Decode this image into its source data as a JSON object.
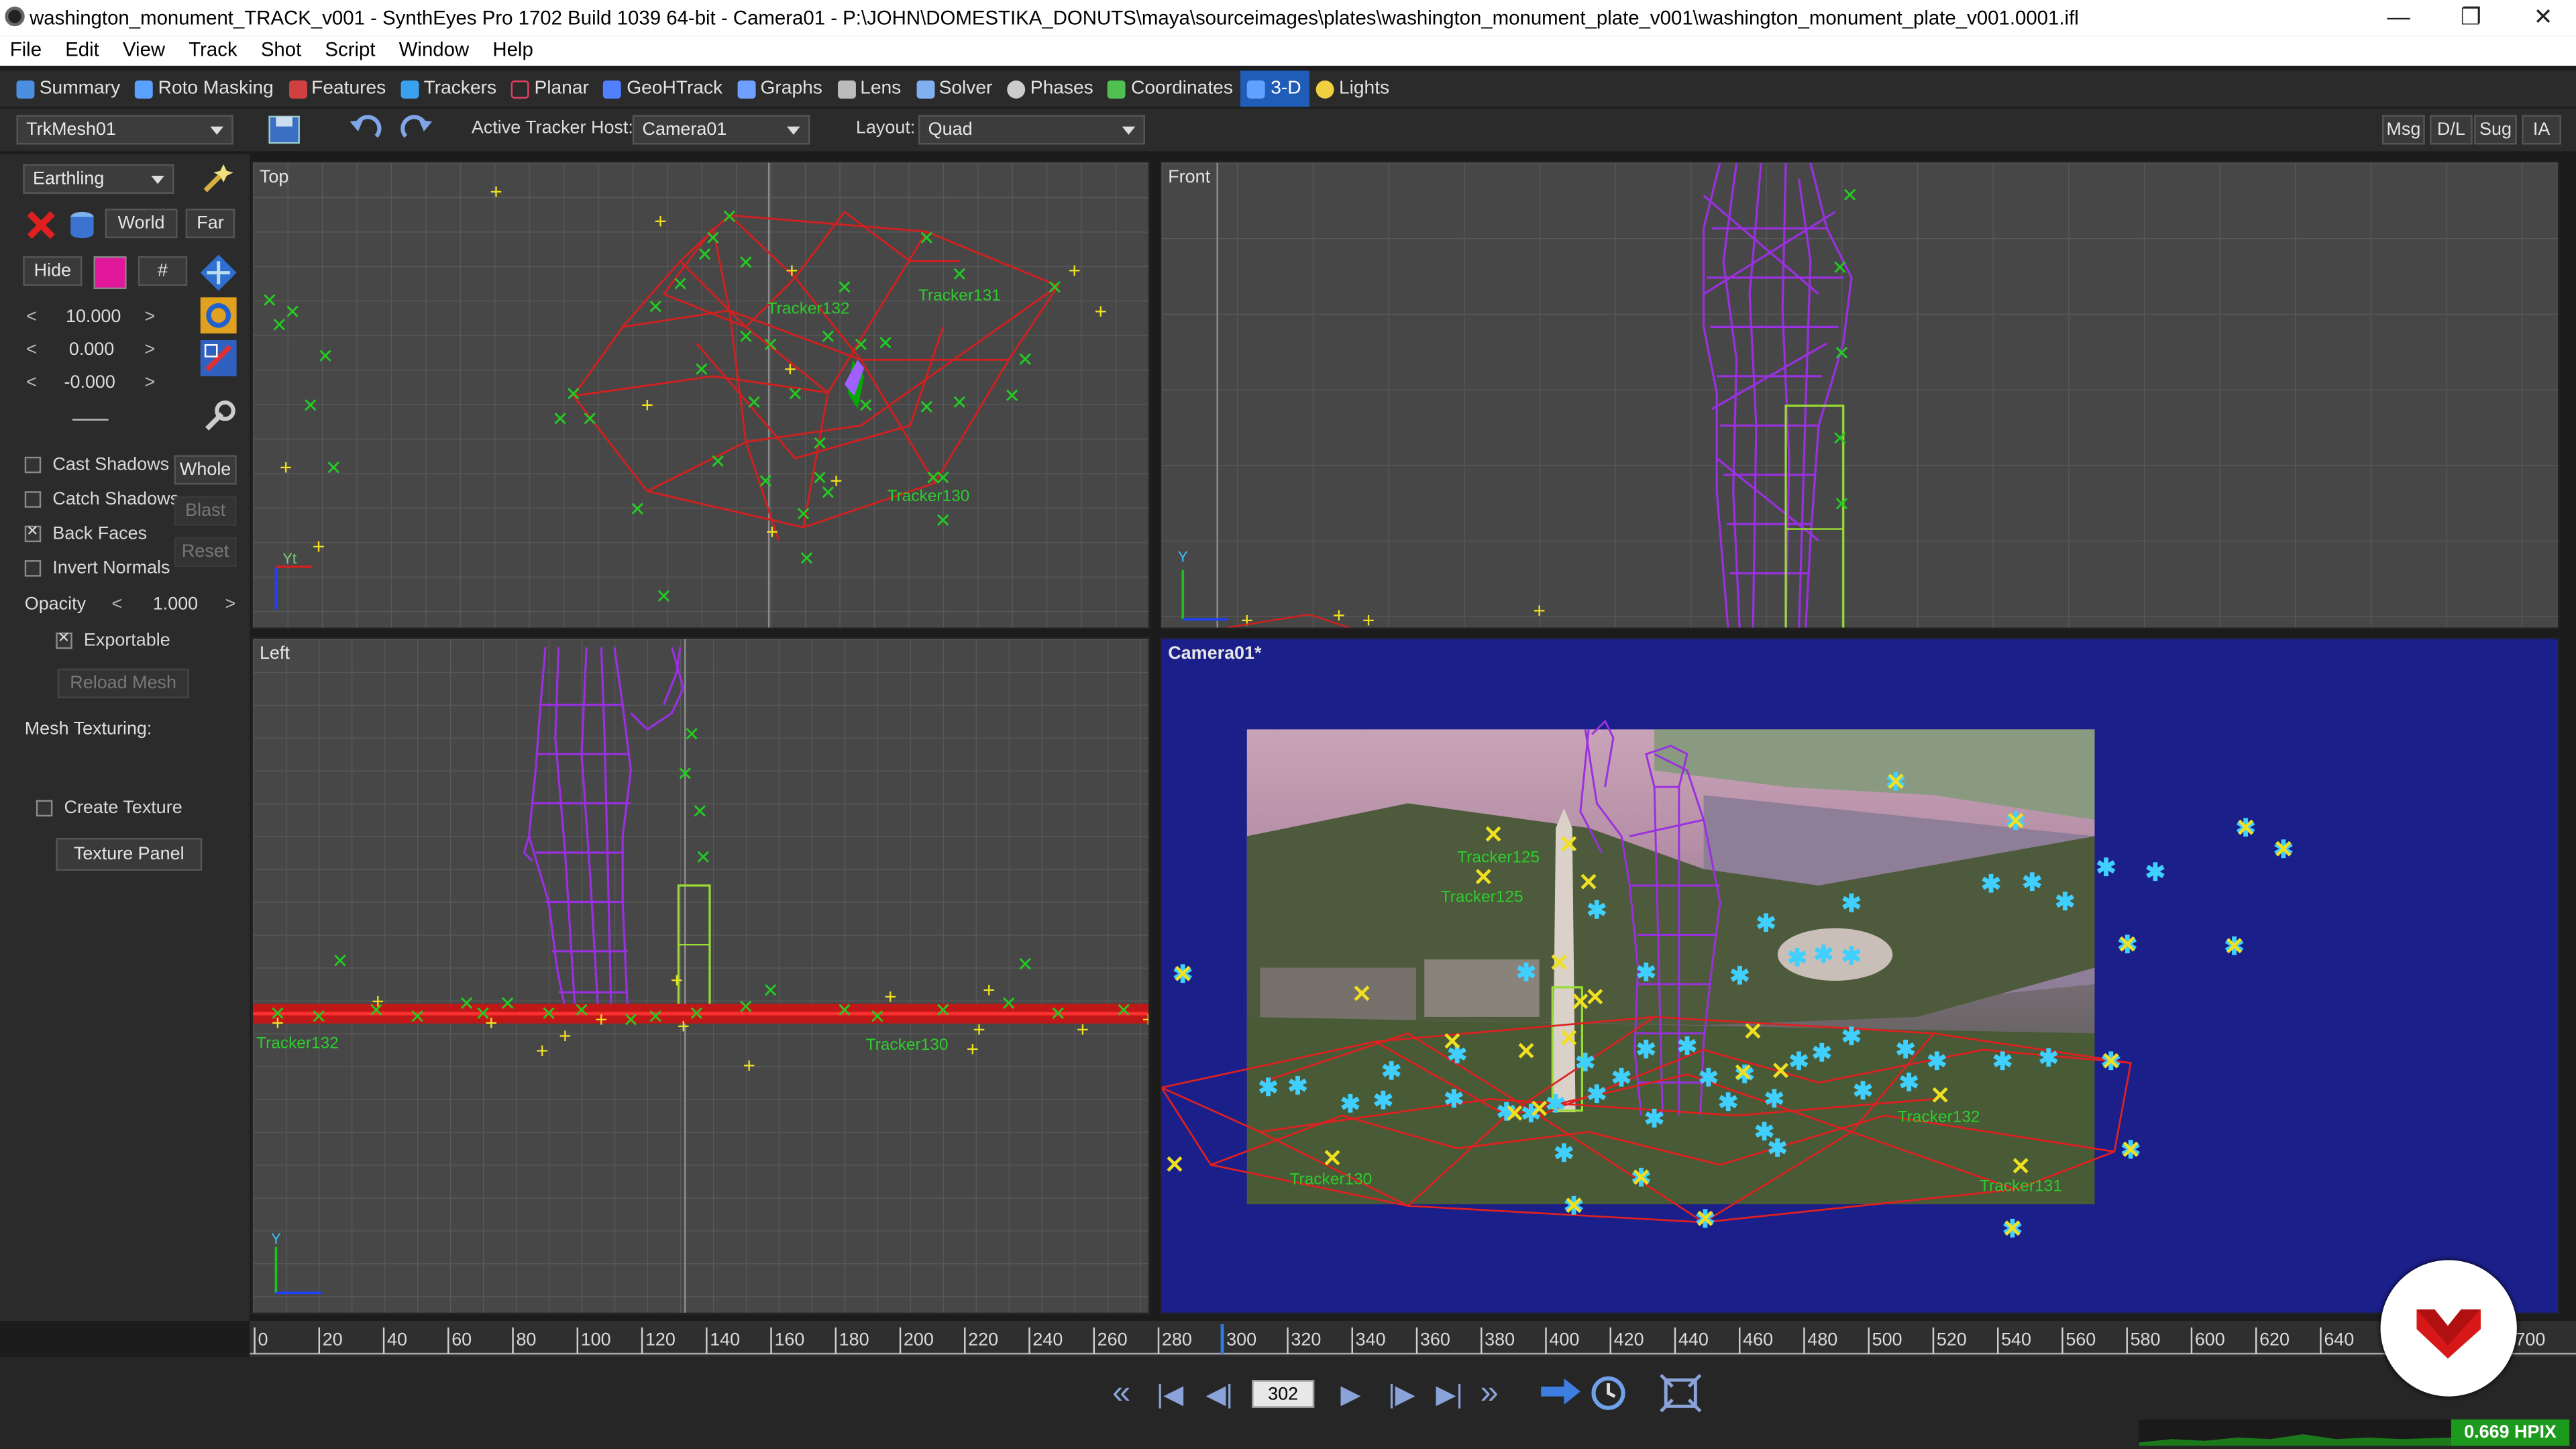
{
  "titlebar": {
    "title": "washington_monument_TRACK_v001 - SynthEyes Pro 1702 Build 1039 64-bit - Camera01 - P:\\JOHN\\DOMESTIKA_DONUTS\\maya\\sourceimages\\plates\\washington_monument_plate_v001\\washington_monument_plate_v001.0001.ifl",
    "minimize": "—",
    "restore": "❐",
    "close": "✕"
  },
  "menu": [
    "File",
    "Edit",
    "View",
    "Track",
    "Shot",
    "Script",
    "Window",
    "Help"
  ],
  "rooms": [
    {
      "label": "Summary",
      "color": "#4a8fe0"
    },
    {
      "label": "Roto Masking",
      "color": "#5aa0ff"
    },
    {
      "label": "Features",
      "color": "#d04040"
    },
    {
      "label": "Trackers",
      "color": "#3aa0f0"
    },
    {
      "label": "Planar",
      "color": "#e04060"
    },
    {
      "label": "GeoHTrack",
      "color": "#5080ff"
    },
    {
      "label": "Graphs",
      "color": "#70a0ff"
    },
    {
      "label": "Lens",
      "color": "#bbbbbb"
    },
    {
      "label": "Solver",
      "color": "#80b0f0"
    },
    {
      "label": "Phases",
      "color": "#cccccc"
    },
    {
      "label": "Coordinates",
      "color": "#50c050"
    },
    {
      "label": "3-D",
      "color": "#60a0ff",
      "active": true
    },
    {
      "label": "Lights",
      "color": "#f0d040"
    }
  ],
  "toolbar": {
    "mesh_select": "TrkMesh01",
    "active_tracker_host_label": "Active Tracker Host:",
    "active_tracker_host": "Camera01",
    "layout_label": "Layout:",
    "layout": "Quad",
    "right_buttons": [
      "Msg",
      "D/L",
      "Sug",
      "IA"
    ]
  },
  "left_panel": {
    "mode_select": "Earthling",
    "world_btn": "World",
    "far_btn": "Far",
    "hide_btn": "Hide",
    "hash_btn": "#",
    "color_swatch": "#e0169b",
    "values": [
      "10.000",
      "0.000",
      "-0.000"
    ],
    "cast_shadows": {
      "label": "Cast Shadows",
      "checked": false
    },
    "catch_shadows": {
      "label": "Catch Shadows",
      "checked": false
    },
    "back_faces": {
      "label": "Back Faces",
      "checked": true
    },
    "invert_normals": {
      "label": "Invert Normals",
      "checked": false
    },
    "whole_btn": "Whole",
    "blast_btn": "Blast",
    "reset_btn": "Reset",
    "opacity_label": "Opacity",
    "opacity_value": "1.000",
    "exportable": {
      "label": "Exportable",
      "checked": true
    },
    "reload_mesh_btn": "Reload Mesh",
    "mesh_texturing_label": "Mesh Texturing:",
    "create_texture": {
      "label": "Create Texture",
      "checked": false
    },
    "texture_panel_btn": "Texture Panel"
  },
  "viewports": {
    "top": {
      "title": "Top",
      "labels": [
        "Tracker132",
        "Tracker131",
        "Tracker130"
      ]
    },
    "front": {
      "title": "Front"
    },
    "left": {
      "title": "Left",
      "labels": [
        "Tracker132",
        "Tracker130"
      ]
    },
    "camera": {
      "title": "Camera01*",
      "labels": [
        "Tracker125",
        "Tracker125",
        "Tracker132",
        "Tracker130",
        "Tracker131"
      ]
    }
  },
  "timeline": {
    "ticks": [
      "0",
      "20",
      "40",
      "60",
      "80",
      "100",
      "120",
      "140",
      "160",
      "180",
      "200",
      "220",
      "240",
      "260",
      "280",
      "300",
      "320",
      "340",
      "360",
      "380",
      "400",
      "420",
      "440",
      "460",
      "480",
      "500",
      "520",
      "540",
      "560",
      "580",
      "600",
      "620",
      "640",
      "700"
    ],
    "current_frame": "302"
  },
  "transport": {
    "rewind": "«",
    "to_start": "|◀",
    "step_back": "◀|",
    "play": "▶",
    "step_fwd": "|▶",
    "to_end": "▶|",
    "fast_fwd": "»"
  },
  "status": {
    "hpix": "0.669 HPIX"
  }
}
